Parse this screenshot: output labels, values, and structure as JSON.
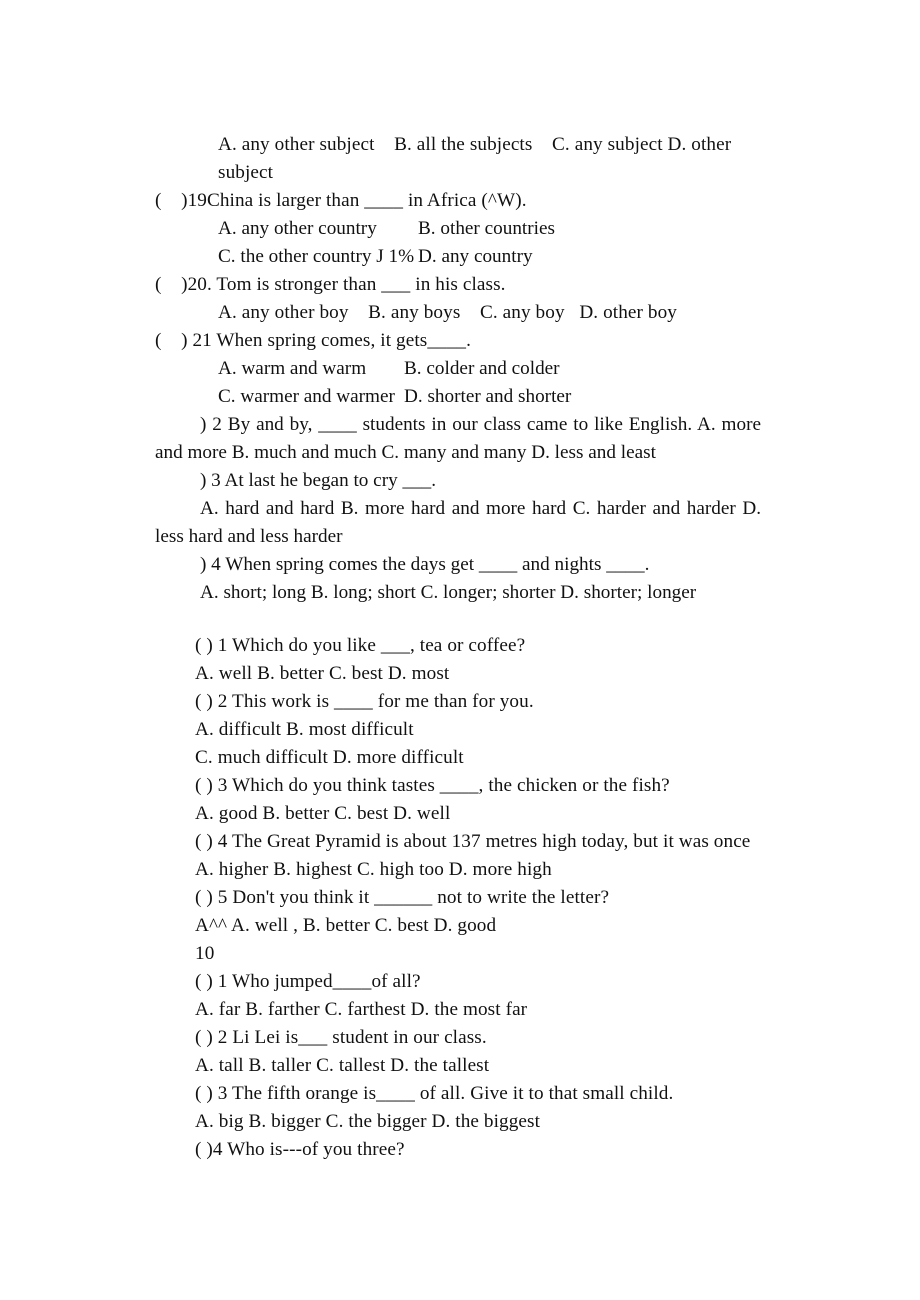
{
  "document": {
    "kind": "scanned-worksheet",
    "subject_hint": "English grammar multiple-choice exercises",
    "page_marker": "10"
  },
  "block1": {
    "lines": [
      {
        "id": "l1",
        "indent": "opt",
        "text": "A. any other subject    B. all the subjects    C. any subject D. other subject"
      },
      {
        "id": "l2",
        "indent": "flush",
        "text": "(    )19China is larger than ____ in Africa (^W)."
      },
      {
        "id": "l3",
        "indent": "opt2",
        "colA": "A. any other country",
        "colB": "B. other countries"
      },
      {
        "id": "l4",
        "indent": "opt2",
        "colA": "C. the other country J 1%",
        "colB": "D. any country"
      },
      {
        "id": "l5",
        "indent": "flush",
        "text": "(    )20. Tom is stronger than ___ in his class."
      },
      {
        "id": "l6",
        "indent": "opt",
        "text": "A. any other boy    B. any boys    C. any boy   D. other boy"
      },
      {
        "id": "l7",
        "indent": "flush",
        "text": "(    ) 21 When spring comes, it gets____."
      },
      {
        "id": "l8",
        "indent": "opt2",
        "colA": "A. warm and warm",
        "colB": "B. colder and colder"
      },
      {
        "id": "l9",
        "indent": "opt2",
        "colA": "C. warmer and warmer",
        "colB": "D. shorter and shorter"
      }
    ],
    "paragraphs": [
      {
        "id": "p1",
        "text": ") 2 By and by, ____ students in our class came to like English. A. more and more B. much and much C. many and many D. less and least"
      },
      {
        "id": "p2",
        "text": ") 3 At last he began to cry ___."
      },
      {
        "id": "p3",
        "text": "A. hard and hard B. more hard and more hard C. harder and harder D. less hard and less harder"
      },
      {
        "id": "p4",
        "text": ") 4 When spring comes the days get ____ and nights ____."
      },
      {
        "id": "p5",
        "text": "A. short; long B. long; short C. longer; shorter D. shorter; longer"
      }
    ]
  },
  "block2": {
    "lines": [
      {
        "id": "b1",
        "text": "( ) 1 Which do you like ___, tea or coffee?"
      },
      {
        "id": "b2",
        "text": "A. well B. better C. best D. most"
      },
      {
        "id": "b3",
        "text": "( ) 2 This work is ____ for me than for you."
      },
      {
        "id": "b4",
        "text": "A. difficult B. most difficult"
      },
      {
        "id": "b5",
        "text": "C. much difficult D. more difficult"
      },
      {
        "id": "b6",
        "text": "( ) 3 Which do you think tastes ____, the chicken or the fish?"
      },
      {
        "id": "b7",
        "text": "A. good B. better C. best D. well"
      },
      {
        "id": "b8",
        "text": "( ) 4 The Great Pyramid is about 137 metres high today, but it was once"
      },
      {
        "id": "b9",
        "text": "A. higher B. highest C. high too D. more high"
      },
      {
        "id": "b10",
        "text": "( ) 5 Don't you think it ______ not to write the letter?"
      },
      {
        "id": "b11",
        "text": "A^^ A. well , B. better C. best D. good"
      },
      {
        "id": "b12",
        "text": "10"
      },
      {
        "id": "b13",
        "text": "( ) 1 Who jumped____of all?"
      },
      {
        "id": "b14",
        "text": "A. far B. farther C. farthest D. the most far"
      },
      {
        "id": "b15",
        "text": "( ) 2 Li Lei is___ student in our class."
      },
      {
        "id": "b16",
        "text": "A. tall B. taller C. tallest D. the tallest"
      },
      {
        "id": "b17",
        "text": "( ) 3 The fifth orange is____ of all. Give it to that small child."
      },
      {
        "id": "b18",
        "text": "A. big B. bigger C. the bigger D. the biggest"
      },
      {
        "id": "b19",
        "text": "( )4 Who is---of you three?"
      }
    ]
  },
  "colors": {
    "page_background": "#ffffff",
    "text": "#111111"
  }
}
